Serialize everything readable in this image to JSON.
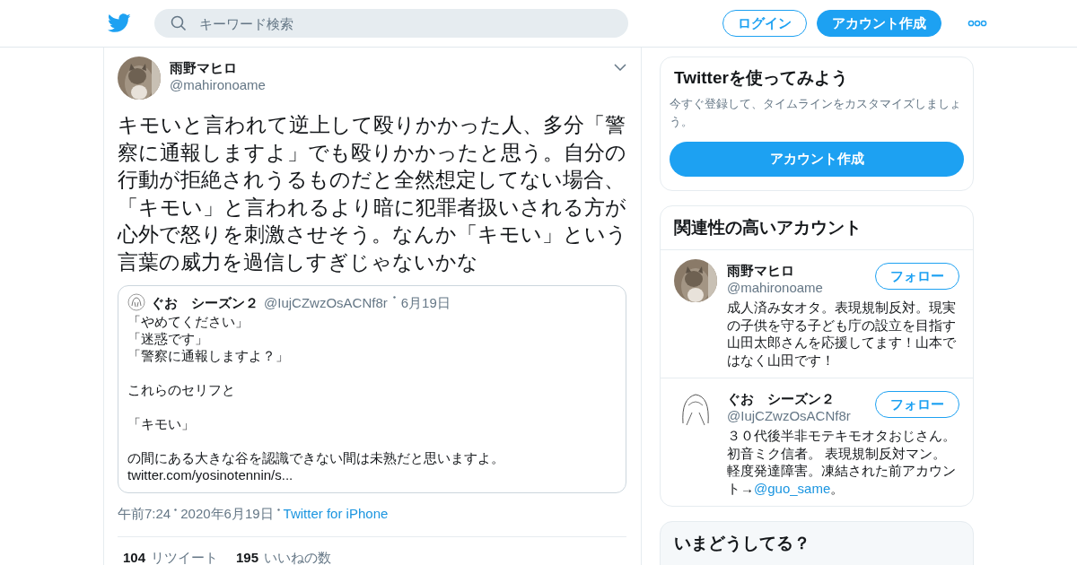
{
  "header": {
    "search": {
      "placeholder": "キーワード検索"
    },
    "login": "ログイン",
    "signup": "アカウント作成"
  },
  "tweet": {
    "name": "雨野マヒロ",
    "handle": "@mahironoame",
    "text": "キモいと言われて逆上して殴りかかった人、多分「警察に通報しますよ」でも殴りかかったと思う。自分の行動が拒絶されうるものだと全然想定してない場合、「キモい」と言われるより暗に犯罪者扱いされる方が心外で怒りを刺激させそう。なんか「キモい」という言葉の威力を過信しすぎじゃないかな",
    "quote": {
      "name": "ぐお　シーズン２",
      "handle": "@IujCZwzOsACNf8r",
      "date": "6月19日",
      "paragraphs": [
        [
          "「やめてください」",
          "「迷惑です」",
          "「警察に通報しますよ？」"
        ],
        [
          "これらのセリフと"
        ],
        [
          "「キモい」"
        ],
        [
          "の間にある大きな谷を認識できない間は未熟だと思いますよ。",
          "twitter.com/yosinotennin/s..."
        ]
      ]
    },
    "time": "午前7:24",
    "date": "2020年6月19日",
    "source": "Twitter for iPhone",
    "stats": [
      {
        "count": "104",
        "label": "リツイート"
      },
      {
        "count": "195",
        "label": "いいねの数"
      }
    ]
  },
  "signup_card": {
    "title": "Twitterを使ってみよう",
    "text": "今すぐ登録して、タイムラインをカスタマイズしましょう。",
    "button": "アカウント作成"
  },
  "related": {
    "title": "関連性の高いアカウント",
    "accounts": [
      {
        "name": "雨野マヒロ",
        "handle": "@mahironoame",
        "button": "フォロー",
        "bio": "成人済み女オタ。表現規制反対。現実の子供を守る子ども庁の設立を目指す山田太郎さんを応援してます！山本ではなく山田です！"
      },
      {
        "name": "ぐお　シーズン２",
        "handle": "@IujCZwzOsACNf8r",
        "button": "フォロー",
        "bio": "３０代後半非モテキモオタおじさん。初音ミク信者。 表現規制反対マン。軽度発達障害。凍結された前アカウント→",
        "bio_link": "@guo_same",
        "bio_end": "。"
      }
    ]
  },
  "trends": {
    "title": "いまどうしてる？"
  }
}
